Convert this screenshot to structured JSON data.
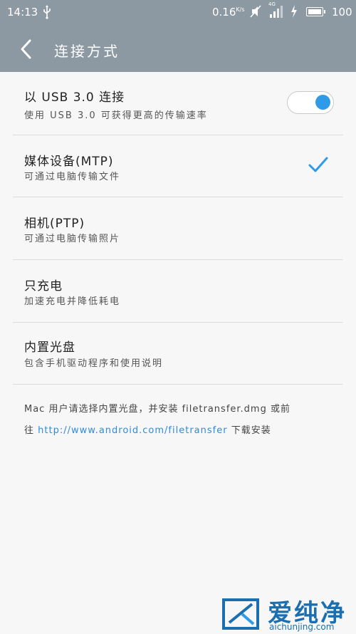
{
  "status_bar": {
    "time": "14:13",
    "speed_value": "0.16",
    "speed_unit": "K/s",
    "network_label": "4G",
    "battery": "100",
    "icons": [
      "usb-icon",
      "mute-icon",
      "signal-icon",
      "charging-icon",
      "battery-icon"
    ]
  },
  "title_bar": {
    "title": "连接方式"
  },
  "options": [
    {
      "title": "以 USB 3.0 连接",
      "subtitle": "使用 USB 3.0 可获得更高的传输速率",
      "control": "toggle",
      "on": true
    },
    {
      "title": "媒体设备(MTP)",
      "subtitle": "可通过电脑传输文件",
      "selected": true
    },
    {
      "title": "相机(PTP)",
      "subtitle": "可通过电脑传输照片",
      "selected": false
    },
    {
      "title": "只充电",
      "subtitle": "加速充电并降低耗电",
      "selected": false
    },
    {
      "title": "内置光盘",
      "subtitle": "包含手机驱动程序和使用说明",
      "selected": false
    }
  ],
  "note": {
    "line1": "Mac 用户请选择内置光盘，并安装 filetransfer.dmg 或前",
    "line2_prefix": "往",
    "link": "http://www.android.com/filetransfer",
    "line2_suffix": "下载安装"
  },
  "watermark": {
    "cn": "爱纯净",
    "en": "aichunjing.com"
  },
  "colors": {
    "header": "#8c98a2",
    "accent": "#2f9be8",
    "link": "#2f8be0",
    "background": "#f7f7f7"
  }
}
